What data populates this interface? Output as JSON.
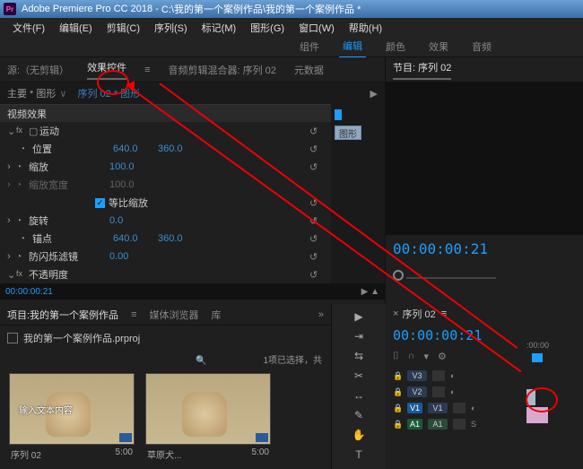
{
  "titlebar": {
    "app": "Adobe Premiere Pro CC 2018",
    "path": "C:\\我的第一个案例作品\\我的第一个案例作品 *"
  },
  "menu": [
    "文件(F)",
    "编辑(E)",
    "剪辑(C)",
    "序列(S)",
    "标记(M)",
    "图形(G)",
    "窗口(W)",
    "帮助(H)"
  ],
  "workspace_tabs": [
    "组件",
    "编辑",
    "颜色",
    "效果",
    "音频"
  ],
  "workspace_active": "编辑",
  "source_tabs": {
    "source": "源:（无剪辑）",
    "effect": "效果控件",
    "mixer": "音频剪辑混合器: 序列 02",
    "meta": "元数据"
  },
  "effect_panel": {
    "master": "主要 * 图形",
    "seq": "序列 02 * 图形",
    "section_video": "视频效果",
    "clip_label": "图形",
    "motion": "运动",
    "position": "位置",
    "position_x": "640.0",
    "position_y": "360.0",
    "scale": "缩放",
    "scale_val": "100.0",
    "scale_w": "缩放宽度",
    "scale_w_val": "100.0",
    "uniform": "等比缩放",
    "rotation": "旋转",
    "rotation_val": "0.0",
    "anchor": "锚点",
    "anchor_x": "640.0",
    "anchor_y": "360.0",
    "flicker": "防闪烁滤镜",
    "flicker_val": "0.00",
    "opacity": "不透明度",
    "timecode": "00:00:00:21"
  },
  "program_panel": {
    "tab": "节目: 序列 02",
    "timecode": "00:00:00:21"
  },
  "project": {
    "tab": "项目:我的第一个案例作品",
    "browser": "媒体浏览器",
    "lib": "库",
    "filename": "我的第一个案例作品.prproj",
    "status": "1项已选择，共",
    "items": [
      {
        "name": "序列 02",
        "dur": "5:00",
        "overlay": "输入文本内容"
      },
      {
        "name": "草原犬...",
        "dur": "5:00",
        "overlay": ""
      }
    ]
  },
  "timeline": {
    "tab": "序列 02",
    "timecode": "00:00:00:21",
    "ruler": ":00:00",
    "tracks_v": [
      "V3",
      "V2",
      "V1"
    ],
    "tracks_a": [
      "A1"
    ]
  }
}
